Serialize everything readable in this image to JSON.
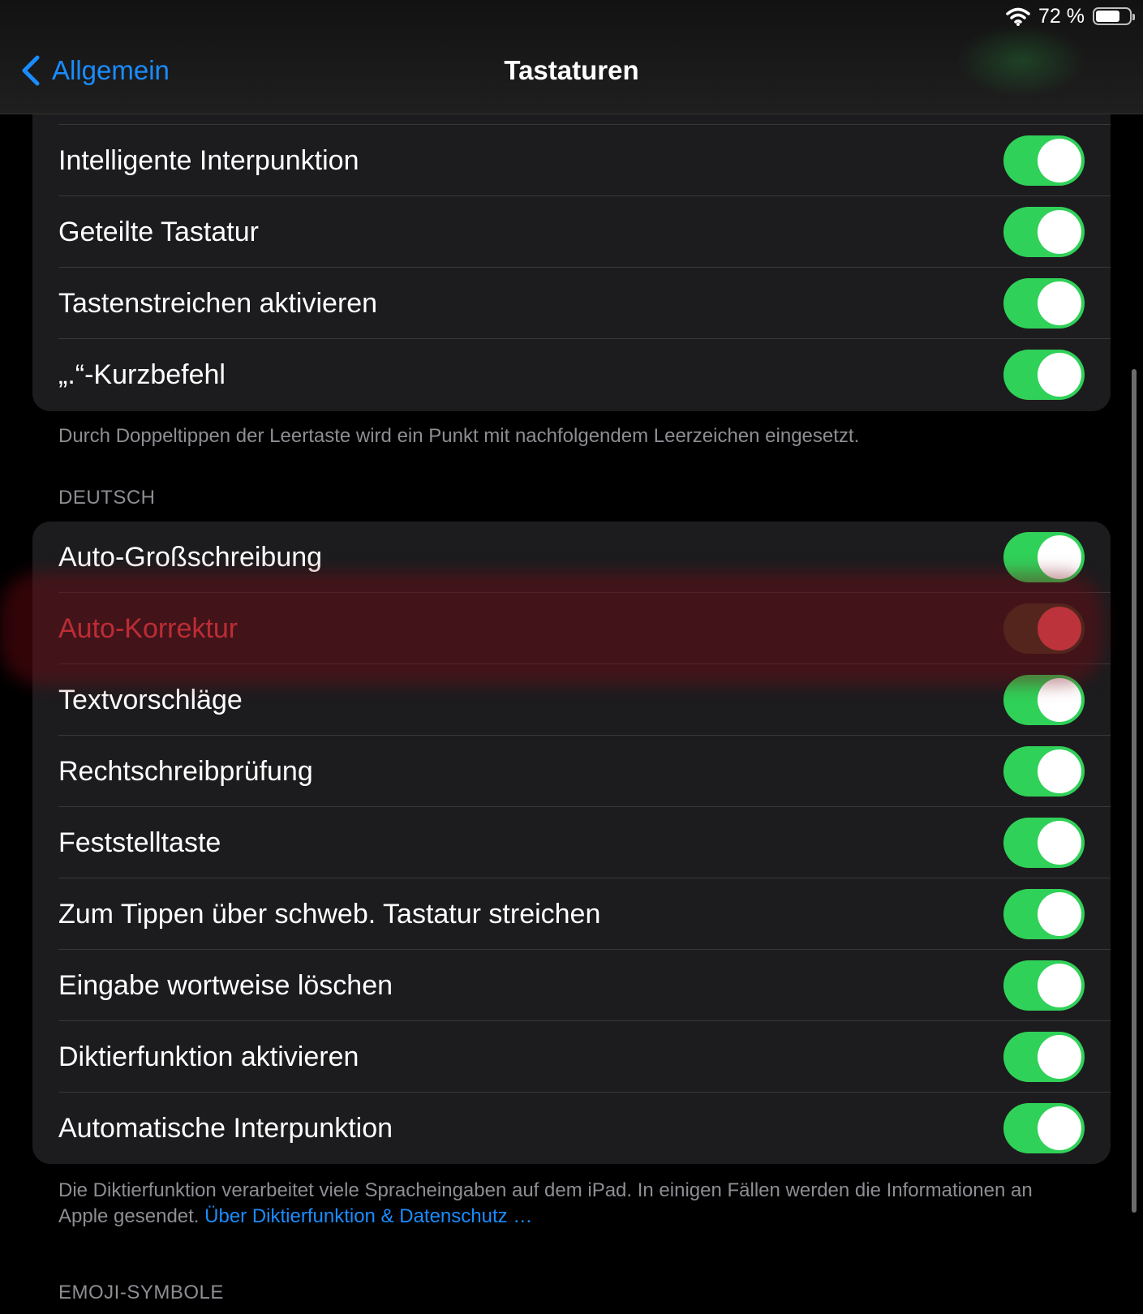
{
  "status_bar": {
    "battery_text": "72 %",
    "battery_level": 0.72,
    "wifi_icon": "wifi-icon"
  },
  "nav": {
    "back_label": "Allgemein",
    "title": "Tastaturen"
  },
  "top_group": {
    "rows": [
      {
        "label": "Intelligente Interpunktion",
        "on": true
      },
      {
        "label": "Geteilte Tastatur",
        "on": true
      },
      {
        "label": "Tastenstreichen aktivieren",
        "on": true
      },
      {
        "label": "„.“-Kurzbefehl",
        "on": true
      }
    ],
    "footer": "Durch Doppeltippen der Leertaste wird ein Punkt mit nachfolgendem Leerzeichen eingesetzt."
  },
  "deutsch_group": {
    "header": "DEUTSCH",
    "rows": [
      {
        "label": "Auto-Großschreibung",
        "on": true
      },
      {
        "label": "Auto-Korrektur",
        "on": true
      },
      {
        "label": "Textvorschläge",
        "on": true
      },
      {
        "label": "Rechtschreibprüfung",
        "on": true
      },
      {
        "label": "Feststelltaste",
        "on": true
      },
      {
        "label": "Zum Tippen über schweb. Tastatur streichen",
        "on": true
      },
      {
        "label": "Eingabe wortweise löschen",
        "on": true
      },
      {
        "label": "Diktierfunktion aktivieren",
        "on": true
      },
      {
        "label": "Automatische Interpunktion",
        "on": true
      }
    ],
    "footer_text": "Die Diktierfunktion verarbeitet viele Spracheingaben auf dem iPad. In einigen Fällen werden die Informationen an Apple gesendet. ",
    "footer_link": "Über Diktierfunktion & Datenschutz …"
  },
  "emoji_section": {
    "header": "EMOJI-SYMBOLE"
  },
  "colors": {
    "accent": "#1a8cff",
    "toggle_on": "#30d158",
    "highlight_red": "#f0454f"
  }
}
